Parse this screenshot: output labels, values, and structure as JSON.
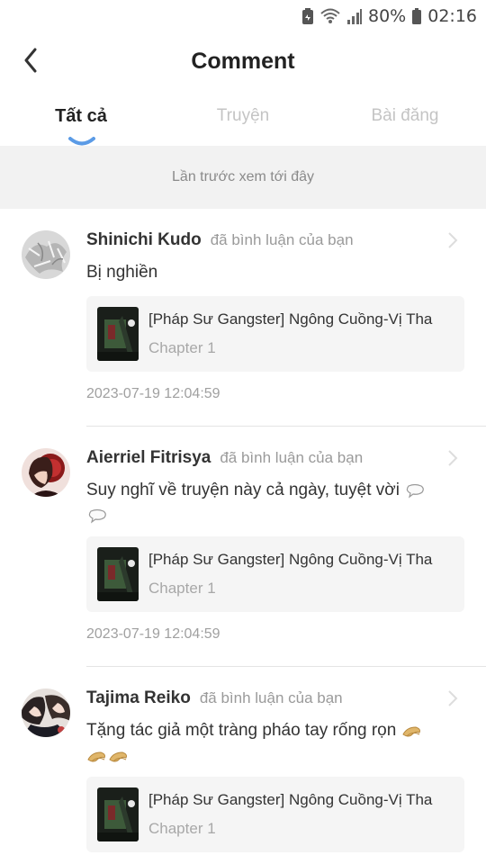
{
  "status_bar": {
    "battery_percent": "80%",
    "time": "02:16",
    "icons": [
      "battery-saver-icon",
      "wifi-icon",
      "signal-icon",
      "battery-icon"
    ]
  },
  "header": {
    "title": "Comment",
    "back_icon": "chevron-left-icon"
  },
  "tabs": [
    {
      "label": "Tất cả",
      "active": true
    },
    {
      "label": "Truyện",
      "active": false
    },
    {
      "label": "Bài đăng",
      "active": false
    }
  ],
  "banner": {
    "text": "Lần trước xem tới đây"
  },
  "comments": [
    {
      "user": "Shinichi Kudo",
      "action": "đã bình luận của bạn",
      "text": "Bị nghiền",
      "emoji_count": 0,
      "emoji_name": "",
      "story_title": "[Pháp Sư Gangster] Ngông Cuồng-Vị Tha",
      "chapter": "Chapter 1",
      "timestamp": "2023-07-19 12:04:59"
    },
    {
      "user": "Aierriel Fitrisya",
      "action": "đã bình luận của bạn",
      "text": "Suy nghĩ về truyện này cả ngày, tuyệt vời",
      "emoji_count": 2,
      "emoji_name": "thought-bubble-emoji",
      "story_title": "[Pháp Sư Gangster] Ngông Cuồng-Vị Tha",
      "chapter": "Chapter 1",
      "timestamp": "2023-07-19 12:04:59"
    },
    {
      "user": "Tajima Reiko",
      "action": "đã bình luận của bạn",
      "text": "Tặng tác giả một tràng pháo tay rống rọn",
      "emoji_count": 3,
      "emoji_name": "clapping-hands-emoji",
      "story_title": "[Pháp Sư Gangster] Ngông Cuồng-Vị Tha",
      "chapter": "Chapter 1",
      "timestamp": ""
    }
  ],
  "colors": {
    "accent": "#5b9be6",
    "banner_bg": "#f2f2f2",
    "card_bg": "#f5f5f5"
  }
}
